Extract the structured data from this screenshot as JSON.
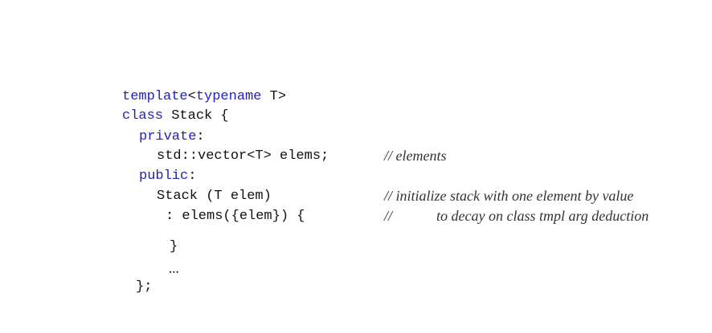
{
  "code": {
    "line1": {
      "kw1": "template",
      "text1": "<",
      "kw2": "typename",
      "text2": " T>"
    },
    "line2": {
      "kw": "class",
      "text": " Stack {"
    },
    "line3": {
      "kw": "private",
      "text": ":"
    },
    "line4": {
      "text": "std::vector<T> elems;"
    },
    "line5": {
      "kw": "public",
      "text": ":"
    },
    "line6": {
      "text": "Stack (T elem)"
    },
    "line7": {
      "text": ": elems({elem}) {"
    },
    "line8": {
      "text": "}"
    },
    "line9": {
      "text": "..."
    },
    "line10": {
      "text": "};"
    }
  },
  "comments": {
    "c1": "// elements",
    "c2": "// initialize stack with one element by value",
    "c3_prefix": "//",
    "c3_text": "to decay on class tmpl arg deduction"
  },
  "colors": {
    "keyword": "#1f1fbf",
    "text": "#111111",
    "comment": "#333333"
  }
}
